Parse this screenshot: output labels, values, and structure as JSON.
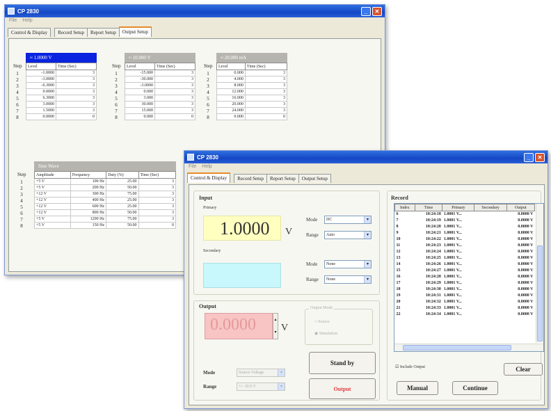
{
  "back_window": {
    "title": "CP 2830",
    "menu": [
      "File",
      "Help"
    ],
    "tabs": [
      "Control & Display",
      "Record Setup",
      "Report Setup",
      "Output Setup"
    ],
    "step_header": "Step",
    "steps": [
      "1",
      "2",
      "3",
      "4",
      "5",
      "6",
      "7",
      "8"
    ],
    "table1": {
      "header": "≈ 1.0000 V",
      "cols": [
        "Level",
        "Time (Sec)"
      ],
      "rows": [
        [
          "-1.0000",
          "3"
        ],
        [
          "-3.0000",
          "3"
        ],
        [
          "-6.3000",
          "3"
        ],
        [
          "0.0000",
          "3"
        ],
        [
          "6.3000",
          "3"
        ],
        [
          "3.0000",
          "3"
        ],
        [
          "1.5000",
          "3"
        ],
        [
          "0.0000",
          "0"
        ]
      ]
    },
    "table2": {
      "header": "≈ 10.000 V",
      "cols": [
        "Level",
        "Time (Sec)"
      ],
      "rows": [
        [
          "-15.000",
          "3"
        ],
        [
          "-30.000",
          "3"
        ],
        [
          "-3.0000",
          "3"
        ],
        [
          "0.000",
          "3"
        ],
        [
          "3.000",
          "3"
        ],
        [
          "30.000",
          "3"
        ],
        [
          "15.000",
          "3"
        ],
        [
          "0.000",
          "0"
        ]
      ]
    },
    "table3": {
      "header": "≈ 20.000 mA",
      "cols": [
        "Level",
        "Time (Sec)"
      ],
      "rows": [
        [
          "0.000",
          "3"
        ],
        [
          "4.000",
          "3"
        ],
        [
          "8.000",
          "3"
        ],
        [
          "12.000",
          "3"
        ],
        [
          "16.000",
          "3"
        ],
        [
          "20.000",
          "3"
        ],
        [
          "24.000",
          "3"
        ],
        [
          "0.000",
          "0"
        ]
      ]
    },
    "sine": {
      "header": "Sine Wave",
      "cols": [
        "Amplitude",
        "Frequency",
        "Duty (%)",
        "Time (Sec)"
      ],
      "rows": [
        [
          "+5 V",
          "100 Hz",
          "25.00",
          "3"
        ],
        [
          "+5 V",
          "200 Hz",
          "50.00",
          "3"
        ],
        [
          "+12 V",
          "300 Hz",
          "75.00",
          "3"
        ],
        [
          "+12 V",
          "400 Hz",
          "25.00",
          "3"
        ],
        [
          "+12 V",
          "600 Hz",
          "25.00",
          "3"
        ],
        [
          "+12 V",
          "800 Hz",
          "50.00",
          "3"
        ],
        [
          "+5 V",
          "1200 Hz",
          "75.00",
          "3"
        ],
        [
          "+5 V",
          "150 Hz",
          "50.00",
          "0"
        ]
      ]
    }
  },
  "front_window": {
    "title": "CP 2830",
    "menu": [
      "File",
      "Help"
    ],
    "tabs": [
      "Control & Display",
      "Record Setup",
      "Report Setup",
      "Output Setup"
    ],
    "input": {
      "title": "Input",
      "primary_label": "Primary",
      "primary_value": "1.0000",
      "primary_unit": "V",
      "secondary_label": "Secondary",
      "mode_label": "Mode",
      "range_label": "Range",
      "primary_mode": "DC",
      "primary_range": "Auto",
      "secondary_mode": "None",
      "secondary_range": "None"
    },
    "output": {
      "title": "Output",
      "value": "0.0000",
      "unit": "V",
      "group_title": "Output Mode",
      "radio1": "Source",
      "radio2": "Simulation",
      "mode_label": "Mode",
      "range_label": "Range",
      "mode_value": "Source Voltage",
      "range_value": "+/- 10.0 V",
      "standby_button": "Stand by",
      "output_button": "Output"
    },
    "record": {
      "title": "Record",
      "cols": [
        "Index",
        "Time",
        "Primary",
        "Secondary",
        "Output"
      ],
      "rows": [
        [
          "6",
          "10:24:18",
          "1.0001 V...",
          "",
          "0.0000 V"
        ],
        [
          "7",
          "10:24:19",
          "1.0001 V...",
          "",
          "0.0000 V"
        ],
        [
          "8",
          "10:24:20",
          "1.0001 V...",
          "",
          "0.0000 V"
        ],
        [
          "9",
          "10:24:21",
          "1.0001 V...",
          "",
          "0.0000 V"
        ],
        [
          "10",
          "10:24:22",
          "1.0001 V...",
          "",
          "0.0000 V"
        ],
        [
          "11",
          "10:24:23",
          "1.0001 V...",
          "",
          "0.0000 V"
        ],
        [
          "12",
          "10:24:24",
          "1.0001 V...",
          "",
          "0.0000 V"
        ],
        [
          "13",
          "10:24:25",
          "1.0001 V...",
          "",
          "0.0000 V"
        ],
        [
          "14",
          "10:24:26",
          "1.0001 V...",
          "",
          "0.0000 V"
        ],
        [
          "15",
          "10:24:27",
          "1.0001 V...",
          "",
          "0.0000 V"
        ],
        [
          "16",
          "10:24:28",
          "1.0001 V...",
          "",
          "0.0000 V"
        ],
        [
          "17",
          "10:24:29",
          "1.0001 V...",
          "",
          "0.0000 V"
        ],
        [
          "18",
          "10:24:30",
          "1.0001 V...",
          "",
          "0.0000 V"
        ],
        [
          "19",
          "10:24:31",
          "1.0001 V...",
          "",
          "0.0000 V"
        ],
        [
          "20",
          "10:24:32",
          "1.0001 V...",
          "",
          "0.0000 V"
        ],
        [
          "21",
          "10:24:33",
          "1.0001 V...",
          "",
          "0.0000 V"
        ],
        [
          "22",
          "10:24:34",
          "1.0001 V...",
          "",
          "0.0000 V"
        ]
      ],
      "include_output": "Include Output",
      "clear_button": "Clear",
      "manual_button": "Manual",
      "continue_button": "Continue"
    }
  },
  "colors": {
    "accent_blue": "#0a24e0",
    "primary_bg": "#ffffc0",
    "secondary_bg": "#c8f8fc",
    "output_bg": "#f8c4c4"
  }
}
